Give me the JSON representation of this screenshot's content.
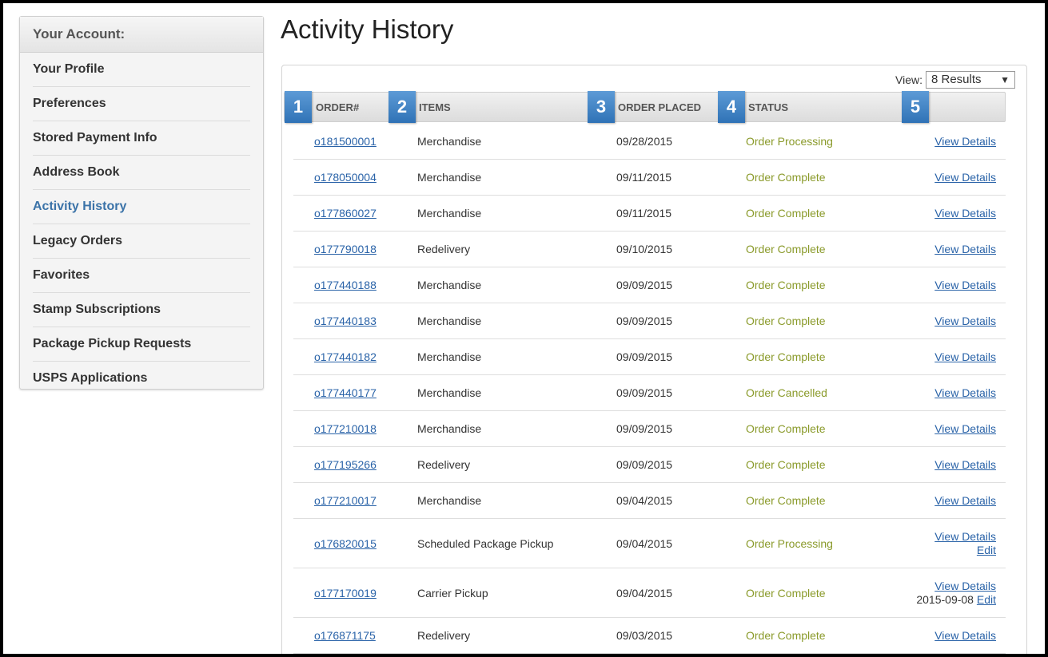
{
  "sidebar": {
    "heading": "Your Account:",
    "items": [
      {
        "label": "Your Profile"
      },
      {
        "label": "Preferences"
      },
      {
        "label": "Stored Payment Info"
      },
      {
        "label": "Address Book"
      },
      {
        "label": "Activity History",
        "active": true
      },
      {
        "label": "Legacy Orders"
      },
      {
        "label": "Favorites"
      },
      {
        "label": "Stamp Subscriptions"
      },
      {
        "label": "Package Pickup Requests"
      },
      {
        "label": "USPS Applications"
      }
    ]
  },
  "main": {
    "title": "Activity History",
    "view_label": "View:",
    "view_value": "8 Results",
    "columns": {
      "order": "ORDER#",
      "items": "ITEMS",
      "placed": "ORDER PLACED",
      "status": "STATUS"
    },
    "markers": [
      "1",
      "2",
      "3",
      "4",
      "5"
    ],
    "rows": [
      {
        "order": "o181500001",
        "items": "Merchandise",
        "date": "09/28/2015",
        "status": "Order Processing",
        "action": "View Details"
      },
      {
        "order": "o178050004",
        "items": "Merchandise",
        "date": "09/11/2015",
        "status": "Order Complete",
        "action": "View Details"
      },
      {
        "order": "o177860027",
        "items": "Merchandise",
        "date": "09/11/2015",
        "status": "Order Complete",
        "action": "View Details"
      },
      {
        "order": "o177790018",
        "items": "Redelivery",
        "date": "09/10/2015",
        "status": "Order Complete",
        "action": "View Details"
      },
      {
        "order": "o177440188",
        "items": "Merchandise",
        "date": "09/09/2015",
        "status": "Order Complete",
        "action": "View Details"
      },
      {
        "order": "o177440183",
        "items": "Merchandise",
        "date": "09/09/2015",
        "status": "Order Complete",
        "action": "View Details"
      },
      {
        "order": "o177440182",
        "items": "Merchandise",
        "date": "09/09/2015",
        "status": "Order Complete",
        "action": "View Details"
      },
      {
        "order": "o177440177",
        "items": "Merchandise",
        "date": "09/09/2015",
        "status": "Order Cancelled",
        "action": "View Details"
      },
      {
        "order": "o177210018",
        "items": "Merchandise",
        "date": "09/09/2015",
        "status": "Order Complete",
        "action": "View Details"
      },
      {
        "order": "o177195266",
        "items": "Redelivery",
        "date": "09/09/2015",
        "status": "Order Complete",
        "action": "View Details"
      },
      {
        "order": "o177210017",
        "items": "Merchandise",
        "date": "09/04/2015",
        "status": "Order Complete",
        "action": "View Details"
      },
      {
        "order": "o176820015",
        "items": "Scheduled Package Pickup",
        "date": "09/04/2015",
        "status": "Order Processing",
        "action": "View Details",
        "edit": "Edit"
      },
      {
        "order": "o177170019",
        "items": "Carrier Pickup",
        "date": "09/04/2015",
        "status": "Order Complete",
        "action": "View Details",
        "edit_date": "2015-09-08",
        "edit": "Edit"
      },
      {
        "order": "o176871175",
        "items": "Redelivery",
        "date": "09/03/2015",
        "status": "Order Complete",
        "action": "View Details"
      }
    ]
  },
  "colors": {
    "link": "#2a63a8",
    "status": "#8a9a2a",
    "marker": "#3a7cc0",
    "active_nav": "#3b73a8"
  }
}
